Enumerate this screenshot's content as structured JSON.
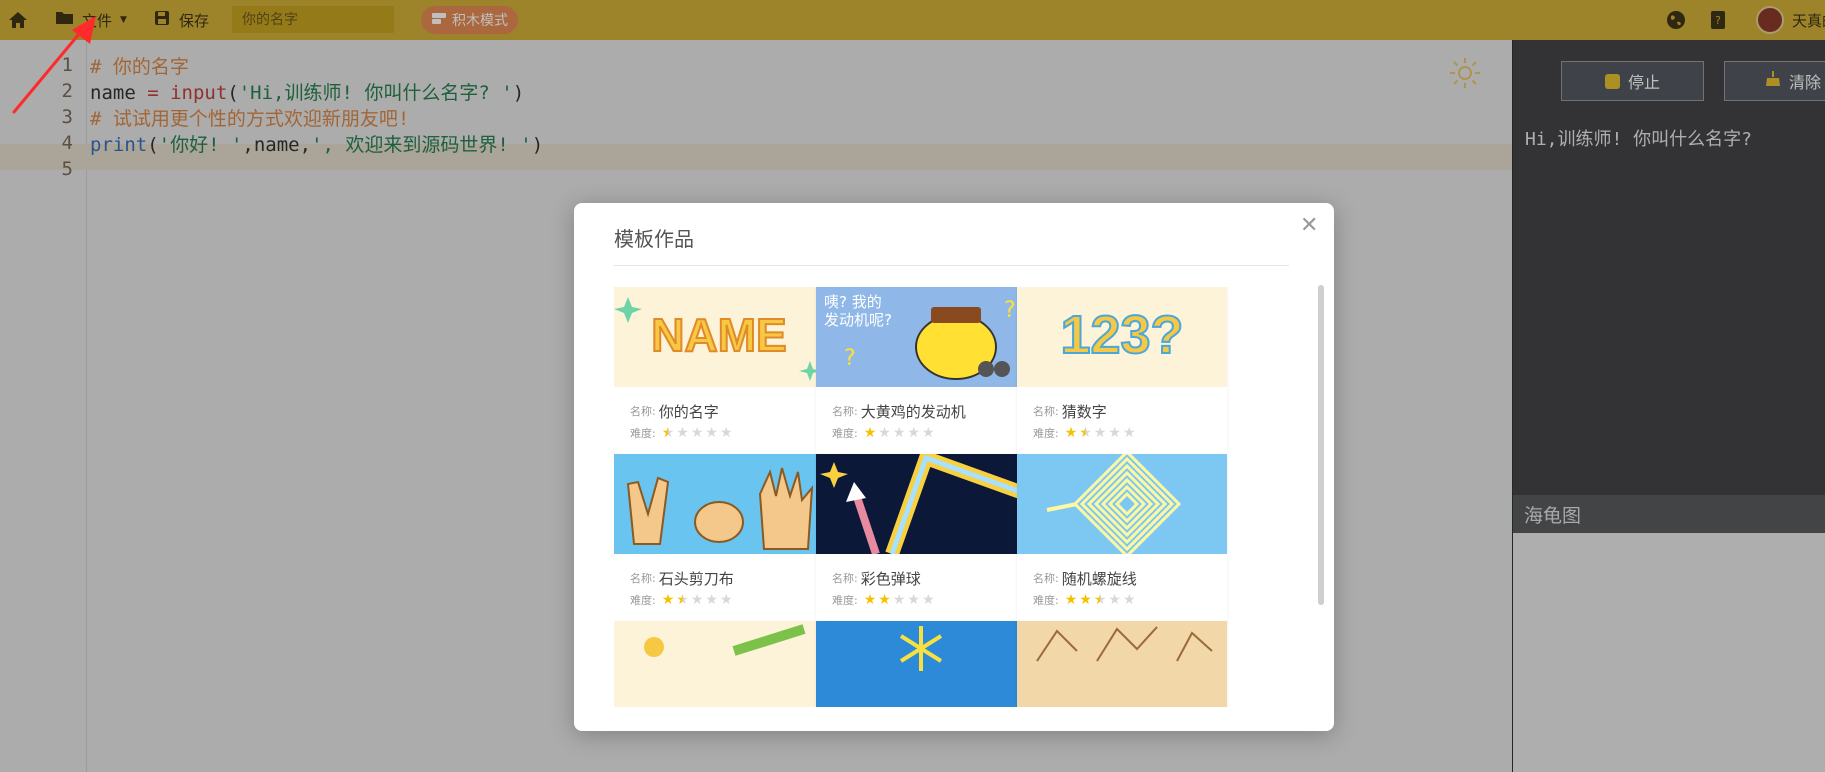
{
  "topbar": {
    "home_icon": "home-icon",
    "file_label": "文件",
    "save_label": "保存",
    "name_input_placeholder": "你的名字",
    "block_mode_label": "积木模式",
    "user_name": "天真的"
  },
  "editor": {
    "lines": [
      {
        "num": "1",
        "tokens": [
          {
            "t": "comment",
            "v": "# 你的名字"
          }
        ]
      },
      {
        "num": "2",
        "tokens": [
          {
            "t": "plain",
            "v": "name "
          },
          {
            "t": "fn",
            "v": "= input"
          },
          {
            "t": "plain",
            "v": "("
          },
          {
            "t": "str",
            "v": "'Hi,训练师! 你叫什么名字? '"
          },
          {
            "t": "plain",
            "v": ")"
          }
        ]
      },
      {
        "num": "3",
        "tokens": [
          {
            "t": "comment",
            "v": "# 试试用更个性的方式欢迎新朋友吧!"
          }
        ]
      },
      {
        "num": "4",
        "tokens": [
          {
            "t": "kw",
            "v": "print"
          },
          {
            "t": "plain",
            "v": "("
          },
          {
            "t": "str",
            "v": "'你好! '"
          },
          {
            "t": "plain",
            "v": ",name,"
          },
          {
            "t": "str",
            "v": "', 欢迎来到源码世界! '"
          },
          {
            "t": "plain",
            "v": ")"
          }
        ]
      },
      {
        "num": "5",
        "tokens": []
      }
    ]
  },
  "right_panel": {
    "stop_label": "停止",
    "clear_label": "清除",
    "console_output": "Hi,训练师! 你叫什么名字?",
    "turtle_title": "海龟图"
  },
  "modal": {
    "title": "模板作品",
    "name_label": "名称:",
    "difficulty_label": "难度:",
    "cards": [
      {
        "name": "你的名字",
        "difficulty": 0.5,
        "thumb": "name",
        "thumb_text": "NAME"
      },
      {
        "name": "大黄鸡的发动机",
        "difficulty": 1,
        "thumb": "chick",
        "thumb_text": "咦? 我的\n发动机呢?"
      },
      {
        "name": "猜数字",
        "difficulty": 1.5,
        "thumb": "numbers",
        "thumb_text": "123?"
      },
      {
        "name": "石头剪刀布",
        "difficulty": 1.5,
        "thumb": "hands"
      },
      {
        "name": "彩色弹球",
        "difficulty": 2,
        "thumb": "pinball"
      },
      {
        "name": "随机螺旋线",
        "difficulty": 2.5,
        "thumb": "spiral"
      },
      {
        "name": "",
        "difficulty": null,
        "thumb": "pencil"
      },
      {
        "name": "",
        "difficulty": null,
        "thumb": "snow"
      },
      {
        "name": "",
        "difficulty": null,
        "thumb": "tree"
      }
    ]
  },
  "colors": {
    "topbar": "#d2b13a",
    "block_button": "#e58a52",
    "star": "#f4c200",
    "annotation_arrow": "#ff2a2a"
  }
}
